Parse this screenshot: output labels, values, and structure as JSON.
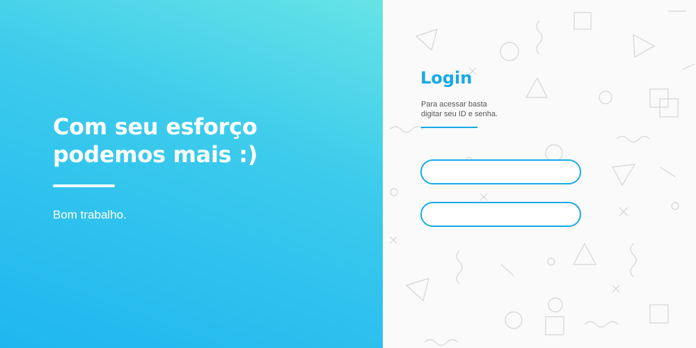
{
  "hero": {
    "headline_line1": "Com seu esforço",
    "headline_line2": "podemos mais :)",
    "subtext": "Bom trabalho."
  },
  "login": {
    "title": "Login",
    "description_line1": "Para acessar basta",
    "description_line2": "digitar seu ID e senha.",
    "id_field": {
      "value": "",
      "placeholder": ""
    },
    "password_field": {
      "value": "",
      "placeholder": ""
    }
  },
  "colors": {
    "accent": "#16a9e6",
    "gradient_top": "#66e3e6",
    "gradient_bottom": "#1fb6f0"
  }
}
